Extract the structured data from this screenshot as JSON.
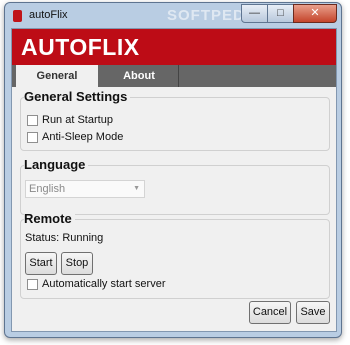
{
  "window": {
    "title": "autoFlix",
    "watermark": "SOFTPEDIA",
    "minimize_glyph": "—",
    "maximize_glyph": "□",
    "close_glyph": "✕"
  },
  "banner": {
    "brand": "AUTOFLIX"
  },
  "tabs": [
    {
      "label": "General",
      "active": true
    },
    {
      "label": "About",
      "active": false
    }
  ],
  "general_settings": {
    "title": "General Settings",
    "options": [
      {
        "label": "Run at Startup",
        "checked": false
      },
      {
        "label": "Anti-Sleep Mode",
        "checked": false
      }
    ]
  },
  "language": {
    "title": "Language",
    "selected": "English"
  },
  "remote": {
    "title": "Remote",
    "status_label": "Status:",
    "status_value": "Running",
    "start_label": "Start",
    "stop_label": "Stop",
    "auto_start_label": "Automatically start server",
    "auto_start_checked": false
  },
  "footer": {
    "cancel_label": "Cancel",
    "save_label": "Save"
  },
  "colors": {
    "brand_red": "#bd0c16",
    "tab_bar": "#666666"
  }
}
